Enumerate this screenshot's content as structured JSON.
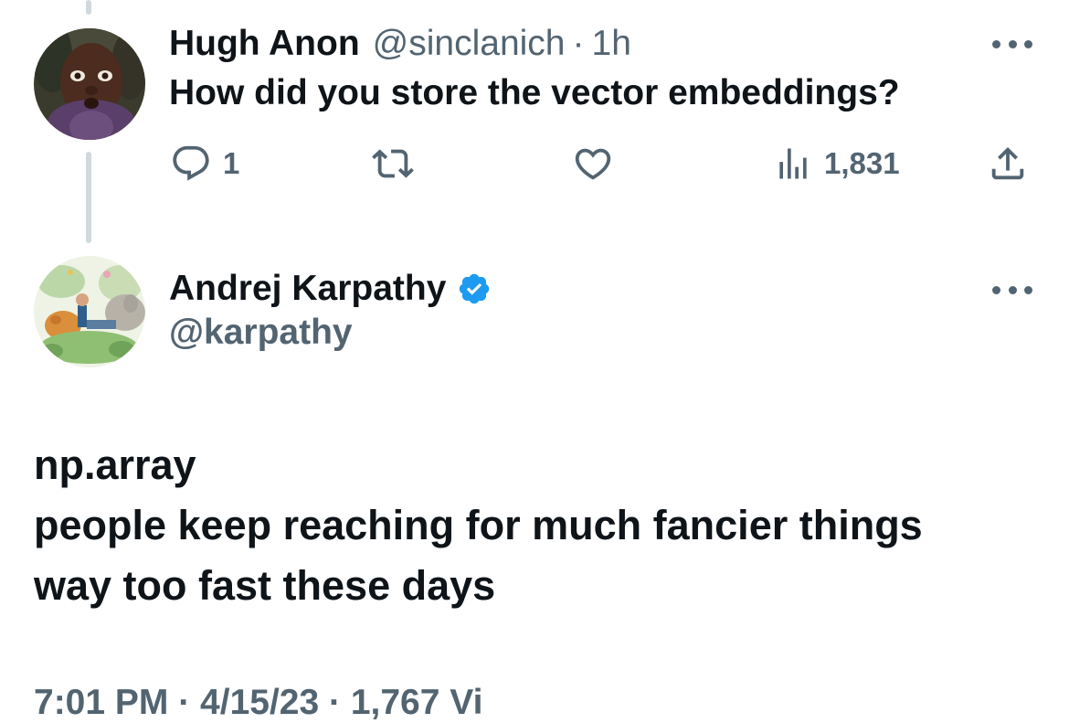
{
  "reply": {
    "author_name": "Hugh Anon",
    "author_handle": "@sinclanich",
    "separator": "·",
    "time": "1h",
    "text": "How did you store the vector embeddings?",
    "stats": {
      "replies": "1",
      "views": "1,831"
    },
    "avatar_icon": "avatar-image"
  },
  "main_tweet": {
    "author_name": "Andrej Karpathy",
    "author_handle": "@karpathy",
    "verified_icon": "verified-badge-icon",
    "body_lines": [
      "np.array",
      "people keep reaching for much fancier things",
      "way too fast these days"
    ],
    "meta": "7:01 PM · 4/15/23 · 1,767 Vi"
  },
  "icons": {
    "reply": "reply-icon",
    "retweet": "retweet-icon",
    "like": "like-icon",
    "views": "views-icon",
    "share": "share-icon",
    "more": "more-icon"
  },
  "colors": {
    "text_primary": "#0f1419",
    "text_secondary": "#536471",
    "thread_line": "#cfd9de",
    "verified": "#1d9bf0"
  }
}
